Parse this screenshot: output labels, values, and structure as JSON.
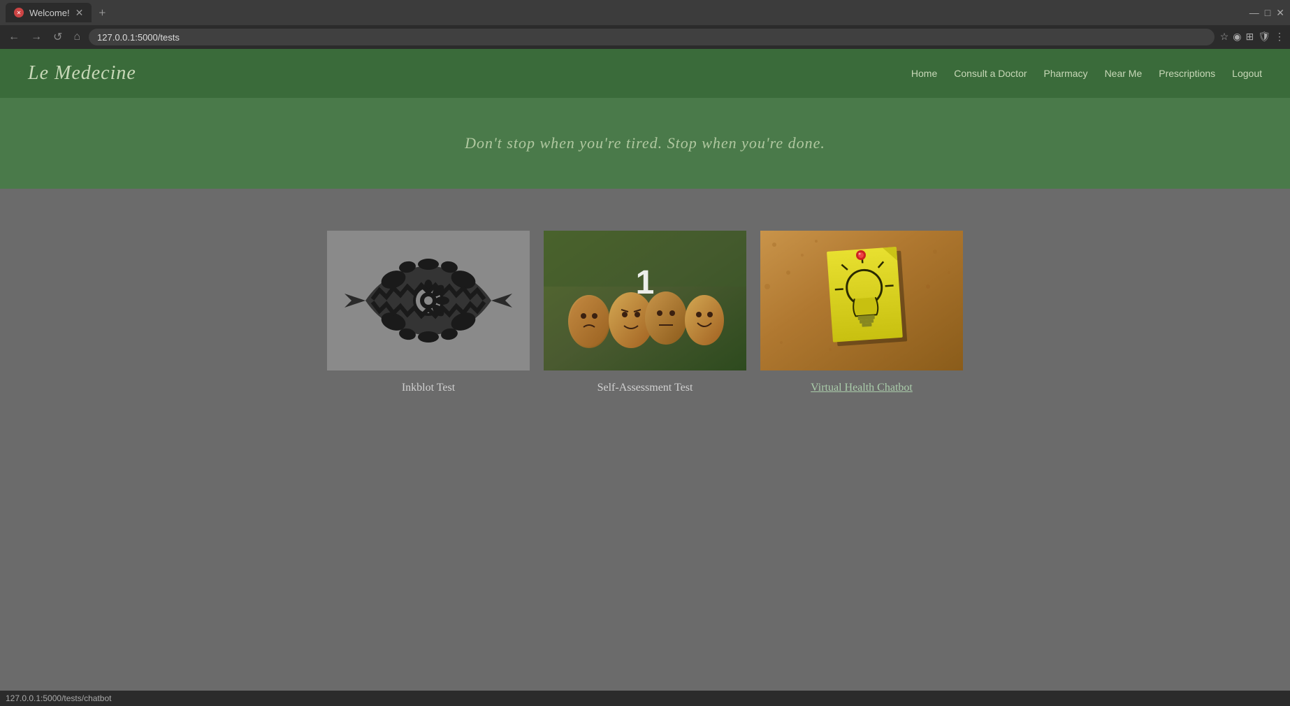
{
  "browser": {
    "tab_title": "Welcome!",
    "tab_favicon": "⊗",
    "url": "127.0.0.1:5000/tests",
    "status_url": "127.0.0.1:5000/tests/chatbot"
  },
  "navbar": {
    "brand": "Le Medecine",
    "links": [
      {
        "label": "Home",
        "href": "#"
      },
      {
        "label": "Consult a Doctor",
        "href": "#"
      },
      {
        "label": "Pharmacy",
        "href": "#"
      },
      {
        "label": "Near Me",
        "href": "#"
      },
      {
        "label": "Prescriptions",
        "href": "#"
      },
      {
        "label": "Logout",
        "href": "#"
      }
    ]
  },
  "hero": {
    "quote": "Don't stop when you're tired. Stop when you're done."
  },
  "cards": [
    {
      "id": "inkblot",
      "label": "Inkblot Test",
      "is_link": false
    },
    {
      "id": "self-assessment",
      "label": "Self-Assessment Test",
      "badge": "1",
      "is_link": false
    },
    {
      "id": "virtual-chatbot",
      "label": "Virtual Health Chatbot",
      "is_link": true
    }
  ],
  "icons": {
    "lightbulb": "💡",
    "back_arrow": "←",
    "forward_arrow": "→",
    "reload": "↺",
    "home": "⌂",
    "star": "☆",
    "extensions": "⊞",
    "profile": "◉",
    "menu": "⋮"
  }
}
